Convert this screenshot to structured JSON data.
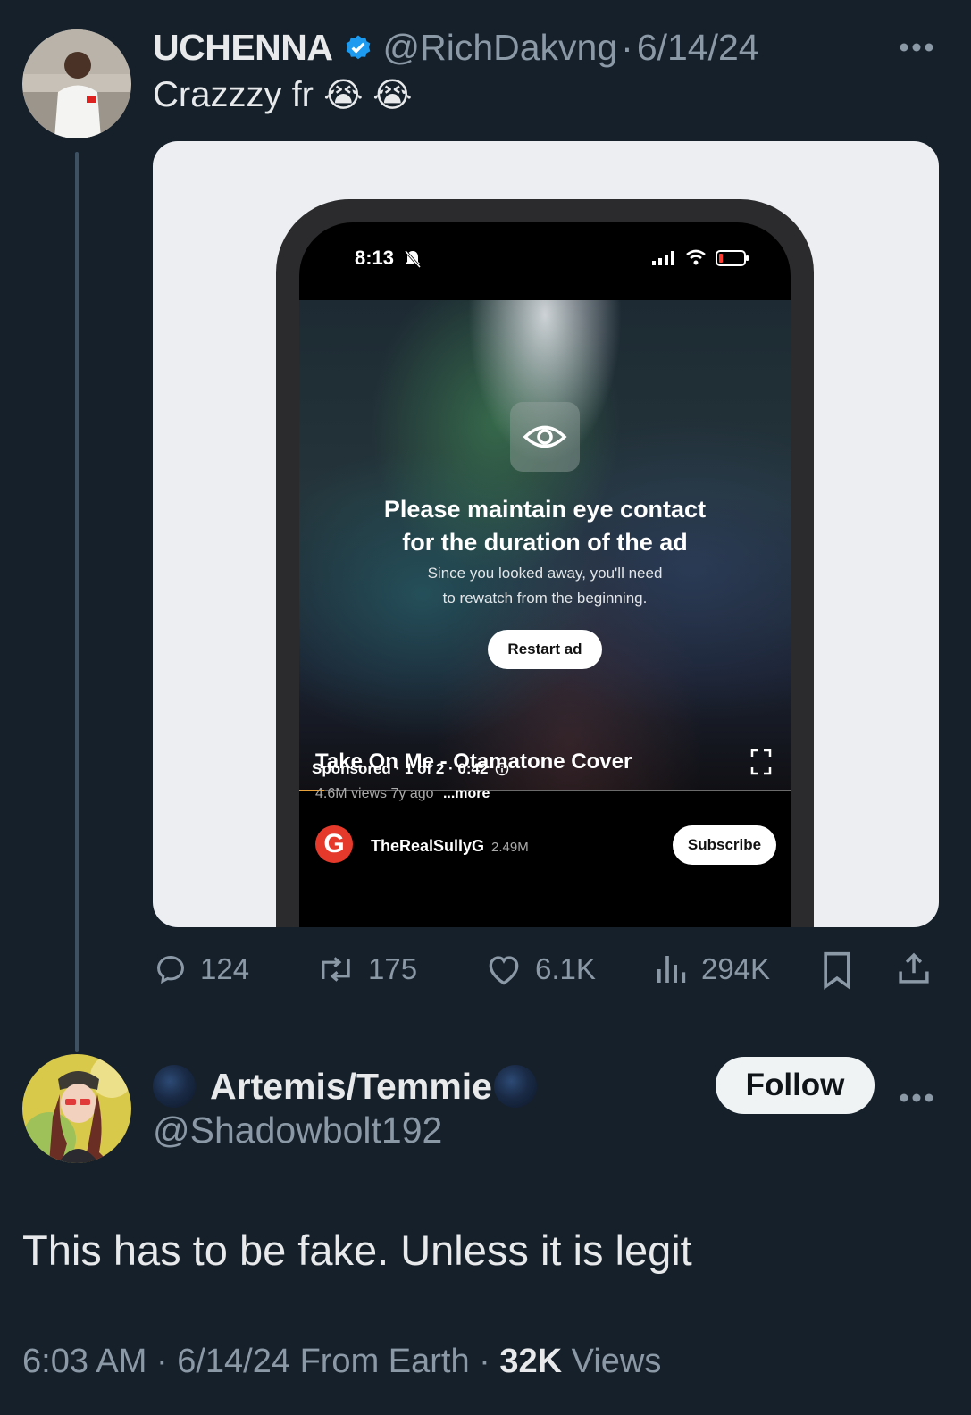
{
  "tweet": {
    "author_name": "UCHENNA",
    "handle": "@RichDakvng",
    "separator": "·",
    "date": "6/14/24",
    "text": "Crazzzy fr",
    "emojis": "😭 😭",
    "more_icon": "more-horizontal-icon",
    "verified_color": "#1d9bf0"
  },
  "media": {
    "status_time": "8:13",
    "ad_title_line1": "Please maintain eye contact",
    "ad_title_line2": "for the duration of the ad",
    "ad_sub_line1": "Since you looked away, you'll need",
    "ad_sub_line2": "to rewatch from the beginning.",
    "restart_label": "Restart ad",
    "sponsored_text": "Sponsored · 1 of 2 · 0:42",
    "progress_fraction": 0.05,
    "video_title": "Take On Me - Otamatone Cover",
    "video_meta": "4.6M views  7y ago",
    "more_label": "...more",
    "channel_logo_letter": "G",
    "channel_name": "TheRealSullyG",
    "channel_subs": "2.49M",
    "subscribe_label": "Subscribe"
  },
  "actions": {
    "replies": "124",
    "reposts": "175",
    "likes": "6.1K",
    "views": "294K"
  },
  "reply": {
    "author_name": "Artemis/Temmie",
    "handle": "@Shadowbolt192",
    "follow_label": "Follow",
    "text": "This has to be fake. Unless it is legit",
    "footer_time": "6:03 AM",
    "footer_sep": "·",
    "footer_date": "6/14/24",
    "footer_location": "From Earth",
    "footer_views_count": "32K",
    "footer_views_label": "Views"
  }
}
